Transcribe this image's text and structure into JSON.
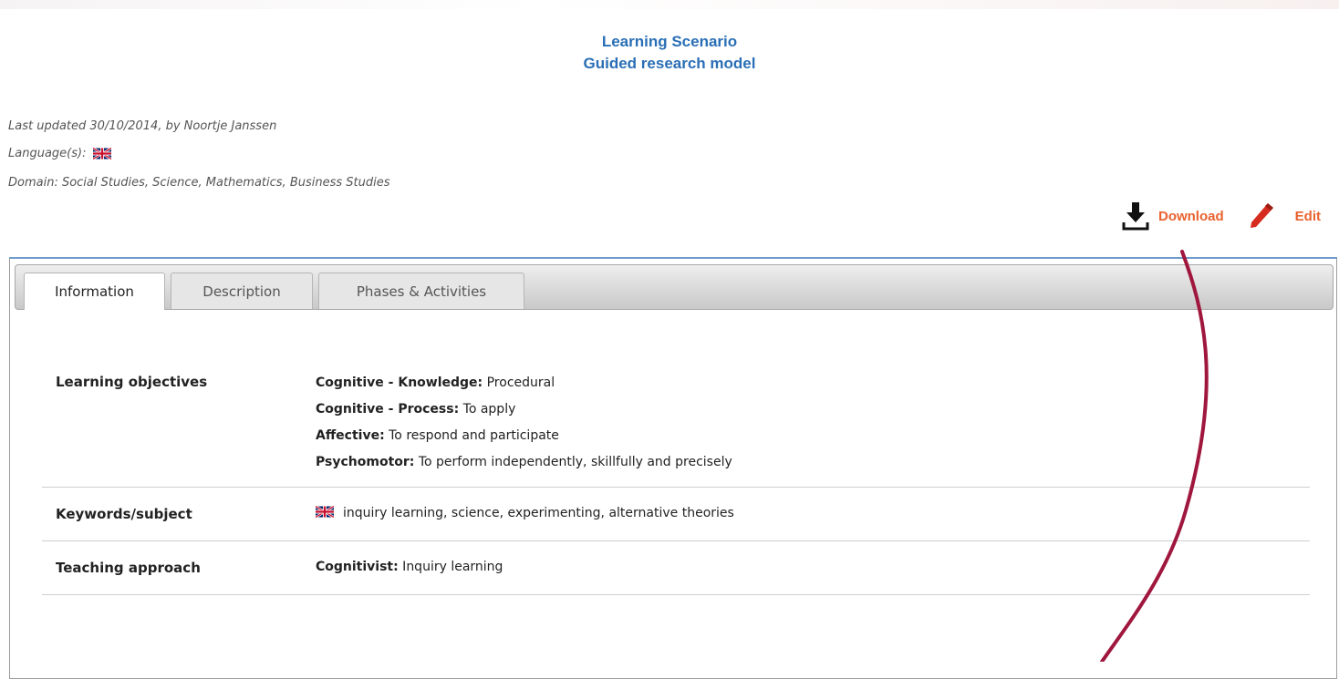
{
  "header": {
    "title_line1": "Learning Scenario",
    "title_line2": "Guided research model"
  },
  "meta": {
    "last_updated": "Last updated 30/10/2014, by Noortje Janssen",
    "languages_label": "Language(s):",
    "language_flag_icon": "uk-flag-icon",
    "domain": "Domain: Social Studies, Science, Mathematics, Business Studies"
  },
  "actions": {
    "download_label": "Download",
    "download_icon": "download-icon",
    "edit_label": "Edit",
    "edit_icon": "pencil-icon"
  },
  "tabs": [
    {
      "label": "Information",
      "active": true
    },
    {
      "label": "Description",
      "active": false
    },
    {
      "label": "Phases & Activities",
      "active": false
    }
  ],
  "information": {
    "learning_objectives": {
      "label": "Learning objectives",
      "items": [
        {
          "key": "Cognitive - Knowledge:",
          "value": " Procedural"
        },
        {
          "key": "Cognitive - Process:",
          "value": " To apply"
        },
        {
          "key": "Affective:",
          "value": " To respond and participate"
        },
        {
          "key": "Psychomotor:",
          "value": " To perform independently, skillfully and precisely"
        }
      ]
    },
    "keywords": {
      "label": "Keywords/subject",
      "value": "inquiry learning, science, experimenting, alternative theories"
    },
    "teaching_approach": {
      "label": "Teaching approach",
      "key": "Cognitivist:",
      "value": " Inquiry learning"
    }
  },
  "colors": {
    "title": "#2a6fb5",
    "action": "#e8622f",
    "annotation_line": "#a0173e"
  }
}
